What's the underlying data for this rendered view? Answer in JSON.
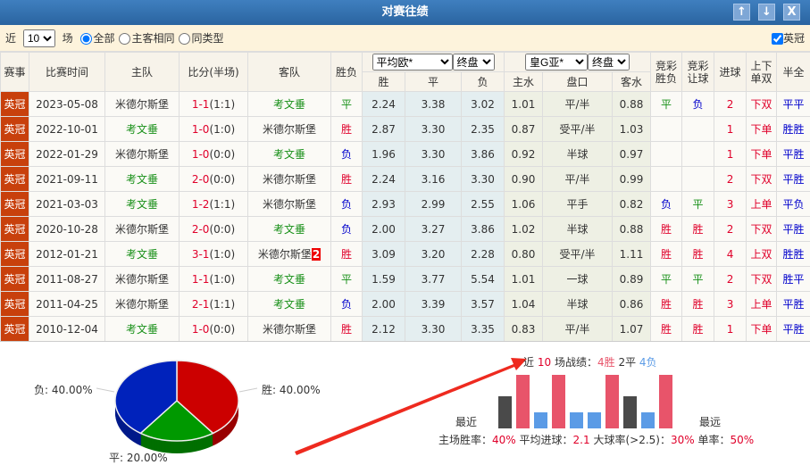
{
  "title": "对赛往绩",
  "window_buttons": {
    "up": "↑",
    "down": "↓",
    "close": "X"
  },
  "filter": {
    "prefix": "近",
    "count": "10",
    "suffix": "场",
    "options": [
      "全部",
      "主客相同",
      "同类型"
    ],
    "selected": "全部",
    "league_check": "英冠"
  },
  "headers": {
    "league": "赛事",
    "date": "比赛时间",
    "home": "主队",
    "score": "比分(半场)",
    "away": "客队",
    "result": "胜负",
    "eu_company": "平均欧*",
    "eu_type": "终盘",
    "asia_company": "皇G亚*",
    "asia_type": "终盘",
    "win": "胜",
    "draw": "平",
    "lose": "负",
    "home_w": "主水",
    "handicap": "盘口",
    "away_w": "客水",
    "jc_result": "竞彩胜负",
    "jc_hcp": "竞彩让球",
    "goals": "进球",
    "ou": "上下单双",
    "hf": "半全"
  },
  "rows": [
    {
      "league": "英冠",
      "date": "2023-05-08",
      "home": "米德尔斯堡",
      "hc": "blk",
      "score": "1-1",
      "half": "(1:1)",
      "away": "考文垂",
      "ac": "green",
      "card": "",
      "res": "平",
      "rc": "green",
      "w": "2.24",
      "d": "3.38",
      "l": "3.02",
      "hw": "1.01",
      "hcp": "平/半",
      "aw": "0.88",
      "jr": "平",
      "jrc": "green",
      "jh": "负",
      "jhc": "blue",
      "g": "2",
      "ou": "下双",
      "hf": "平平"
    },
    {
      "league": "英冠",
      "date": "2022-10-01",
      "home": "考文垂",
      "hc": "green",
      "score": "1-0",
      "half": "(1:0)",
      "away": "米德尔斯堡",
      "ac": "blk",
      "card": "",
      "res": "胜",
      "rc": "red",
      "w": "2.87",
      "d": "3.30",
      "l": "2.35",
      "hw": "0.87",
      "hcp": "受平/半",
      "aw": "1.03",
      "jr": "",
      "jrc": "",
      "jh": "",
      "jhc": "",
      "g": "1",
      "ou": "下单",
      "hf": "胜胜"
    },
    {
      "league": "英冠",
      "date": "2022-01-29",
      "home": "米德尔斯堡",
      "hc": "blk",
      "score": "1-0",
      "half": "(0:0)",
      "away": "考文垂",
      "ac": "green",
      "card": "",
      "res": "负",
      "rc": "blue",
      "w": "1.96",
      "d": "3.30",
      "l": "3.86",
      "hw": "0.92",
      "hcp": "半球",
      "aw": "0.97",
      "jr": "",
      "jrc": "",
      "jh": "",
      "jhc": "",
      "g": "1",
      "ou": "下单",
      "hf": "平胜"
    },
    {
      "league": "英冠",
      "date": "2021-09-11",
      "home": "考文垂",
      "hc": "green",
      "score": "2-0",
      "half": "(0:0)",
      "away": "米德尔斯堡",
      "ac": "blk",
      "card": "",
      "res": "胜",
      "rc": "red",
      "w": "2.24",
      "d": "3.16",
      "l": "3.30",
      "hw": "0.90",
      "hcp": "平/半",
      "aw": "0.99",
      "jr": "",
      "jrc": "",
      "jh": "",
      "jhc": "",
      "g": "2",
      "ou": "下双",
      "hf": "平胜"
    },
    {
      "league": "英冠",
      "date": "2021-03-03",
      "home": "考文垂",
      "hc": "green",
      "score": "1-2",
      "half": "(1:1)",
      "away": "米德尔斯堡",
      "ac": "blk",
      "card": "",
      "res": "负",
      "rc": "blue",
      "w": "2.93",
      "d": "2.99",
      "l": "2.55",
      "hw": "1.06",
      "hcp": "平手",
      "aw": "0.82",
      "jr": "负",
      "jrc": "blue",
      "jh": "平",
      "jhc": "green",
      "g": "3",
      "ou": "上单",
      "hf": "平负"
    },
    {
      "league": "英冠",
      "date": "2020-10-28",
      "home": "米德尔斯堡",
      "hc": "blk",
      "score": "2-0",
      "half": "(0:0)",
      "away": "考文垂",
      "ac": "green",
      "card": "",
      "res": "负",
      "rc": "blue",
      "w": "2.00",
      "d": "3.27",
      "l": "3.86",
      "hw": "1.02",
      "hcp": "半球",
      "aw": "0.88",
      "jr": "胜",
      "jrc": "red",
      "jh": "胜",
      "jhc": "red",
      "g": "2",
      "ou": "下双",
      "hf": "平胜"
    },
    {
      "league": "英冠",
      "date": "2012-01-21",
      "home": "考文垂",
      "hc": "green",
      "score": "3-1",
      "half": "(1:0)",
      "away": "米德尔斯堡",
      "ac": "blk",
      "card": "2",
      "res": "胜",
      "rc": "red",
      "w": "3.09",
      "d": "3.20",
      "l": "2.28",
      "hw": "0.80",
      "hcp": "受平/半",
      "aw": "1.11",
      "jr": "胜",
      "jrc": "red",
      "jh": "胜",
      "jhc": "red",
      "g": "4",
      "ou": "上双",
      "hf": "胜胜"
    },
    {
      "league": "英冠",
      "date": "2011-08-27",
      "home": "米德尔斯堡",
      "hc": "blk",
      "score": "1-1",
      "half": "(1:0)",
      "away": "考文垂",
      "ac": "green",
      "card": "",
      "res": "平",
      "rc": "green",
      "w": "1.59",
      "d": "3.77",
      "l": "5.54",
      "hw": "1.01",
      "hcp": "一球",
      "aw": "0.89",
      "jr": "平",
      "jrc": "green",
      "jh": "平",
      "jhc": "green",
      "g": "2",
      "ou": "下双",
      "hf": "胜平"
    },
    {
      "league": "英冠",
      "date": "2011-04-25",
      "home": "米德尔斯堡",
      "hc": "blk",
      "score": "2-1",
      "half": "(1:1)",
      "away": "考文垂",
      "ac": "green",
      "card": "",
      "res": "负",
      "rc": "blue",
      "w": "2.00",
      "d": "3.39",
      "l": "3.57",
      "hw": "1.04",
      "hcp": "半球",
      "aw": "0.86",
      "jr": "胜",
      "jrc": "red",
      "jh": "胜",
      "jhc": "red",
      "g": "3",
      "ou": "上单",
      "hf": "平胜"
    },
    {
      "league": "英冠",
      "date": "2010-12-04",
      "home": "考文垂",
      "hc": "green",
      "score": "1-0",
      "half": "(0:0)",
      "away": "米德尔斯堡",
      "ac": "blk",
      "card": "",
      "res": "胜",
      "rc": "red",
      "w": "2.12",
      "d": "3.30",
      "l": "3.35",
      "hw": "0.83",
      "hcp": "平/半",
      "aw": "1.07",
      "jr": "胜",
      "jrc": "red",
      "jh": "胜",
      "jhc": "red",
      "g": "1",
      "ou": "下单",
      "hf": "平胜"
    }
  ],
  "pie": {
    "slices": [
      {
        "label": "胜",
        "text": "胜: 40.00%",
        "value": 40,
        "color": "#cc0000",
        "dark": "#990000"
      },
      {
        "label": "平",
        "text": "平: 20.00%",
        "value": 20,
        "color": "#009900",
        "dark": "#006f00"
      },
      {
        "label": "负",
        "text": "负: 40.00%",
        "value": 40,
        "color": "#0022bb",
        "dark": "#001a8a"
      }
    ]
  },
  "summary": {
    "prefix": "近",
    "n": "10",
    "mid": "场战绩：",
    "wins": "4胜",
    "draws": "2平",
    "losses": "4负",
    "recent": "最近",
    "oldest": "最远",
    "stats": [
      {
        "label": "主场胜率：",
        "value": "40%"
      },
      {
        "label": "平均进球：",
        "value": "2.1"
      },
      {
        "label": "大球率(>2.5)：",
        "value": "30%"
      },
      {
        "label": "单率：",
        "value": "50%"
      }
    ]
  },
  "form_bars": [
    "平",
    "胜",
    "负",
    "胜",
    "负",
    "负",
    "胜",
    "平",
    "负",
    "胜"
  ],
  "colors": {
    "win": "#e8546a",
    "draw": "#4a4a4a",
    "loss": "#5b9be6",
    "arrow": "#ee2a1f"
  }
}
